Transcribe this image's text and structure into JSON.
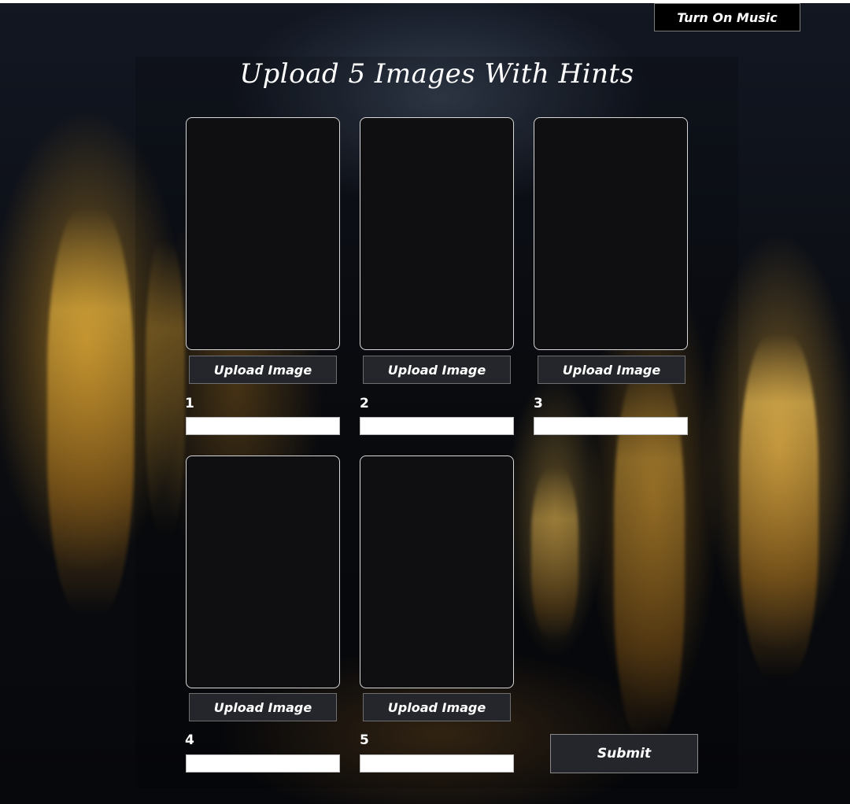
{
  "header": {
    "title": "Upload 5 Images With Hints",
    "music_button_label": "Turn On Music"
  },
  "slots": [
    {
      "number": "1",
      "upload_label": "Upload Image",
      "hint_value": ""
    },
    {
      "number": "2",
      "upload_label": "Upload Image",
      "hint_value": ""
    },
    {
      "number": "3",
      "upload_label": "Upload Image",
      "hint_value": ""
    },
    {
      "number": "4",
      "upload_label": "Upload Image",
      "hint_value": ""
    },
    {
      "number": "5",
      "upload_label": "Upload Image",
      "hint_value": ""
    }
  ],
  "submit_label": "Submit",
  "colors": {
    "slot_background": "#0f0f12",
    "button_background": "#24262b",
    "accent_glow": "#f0aa28"
  }
}
